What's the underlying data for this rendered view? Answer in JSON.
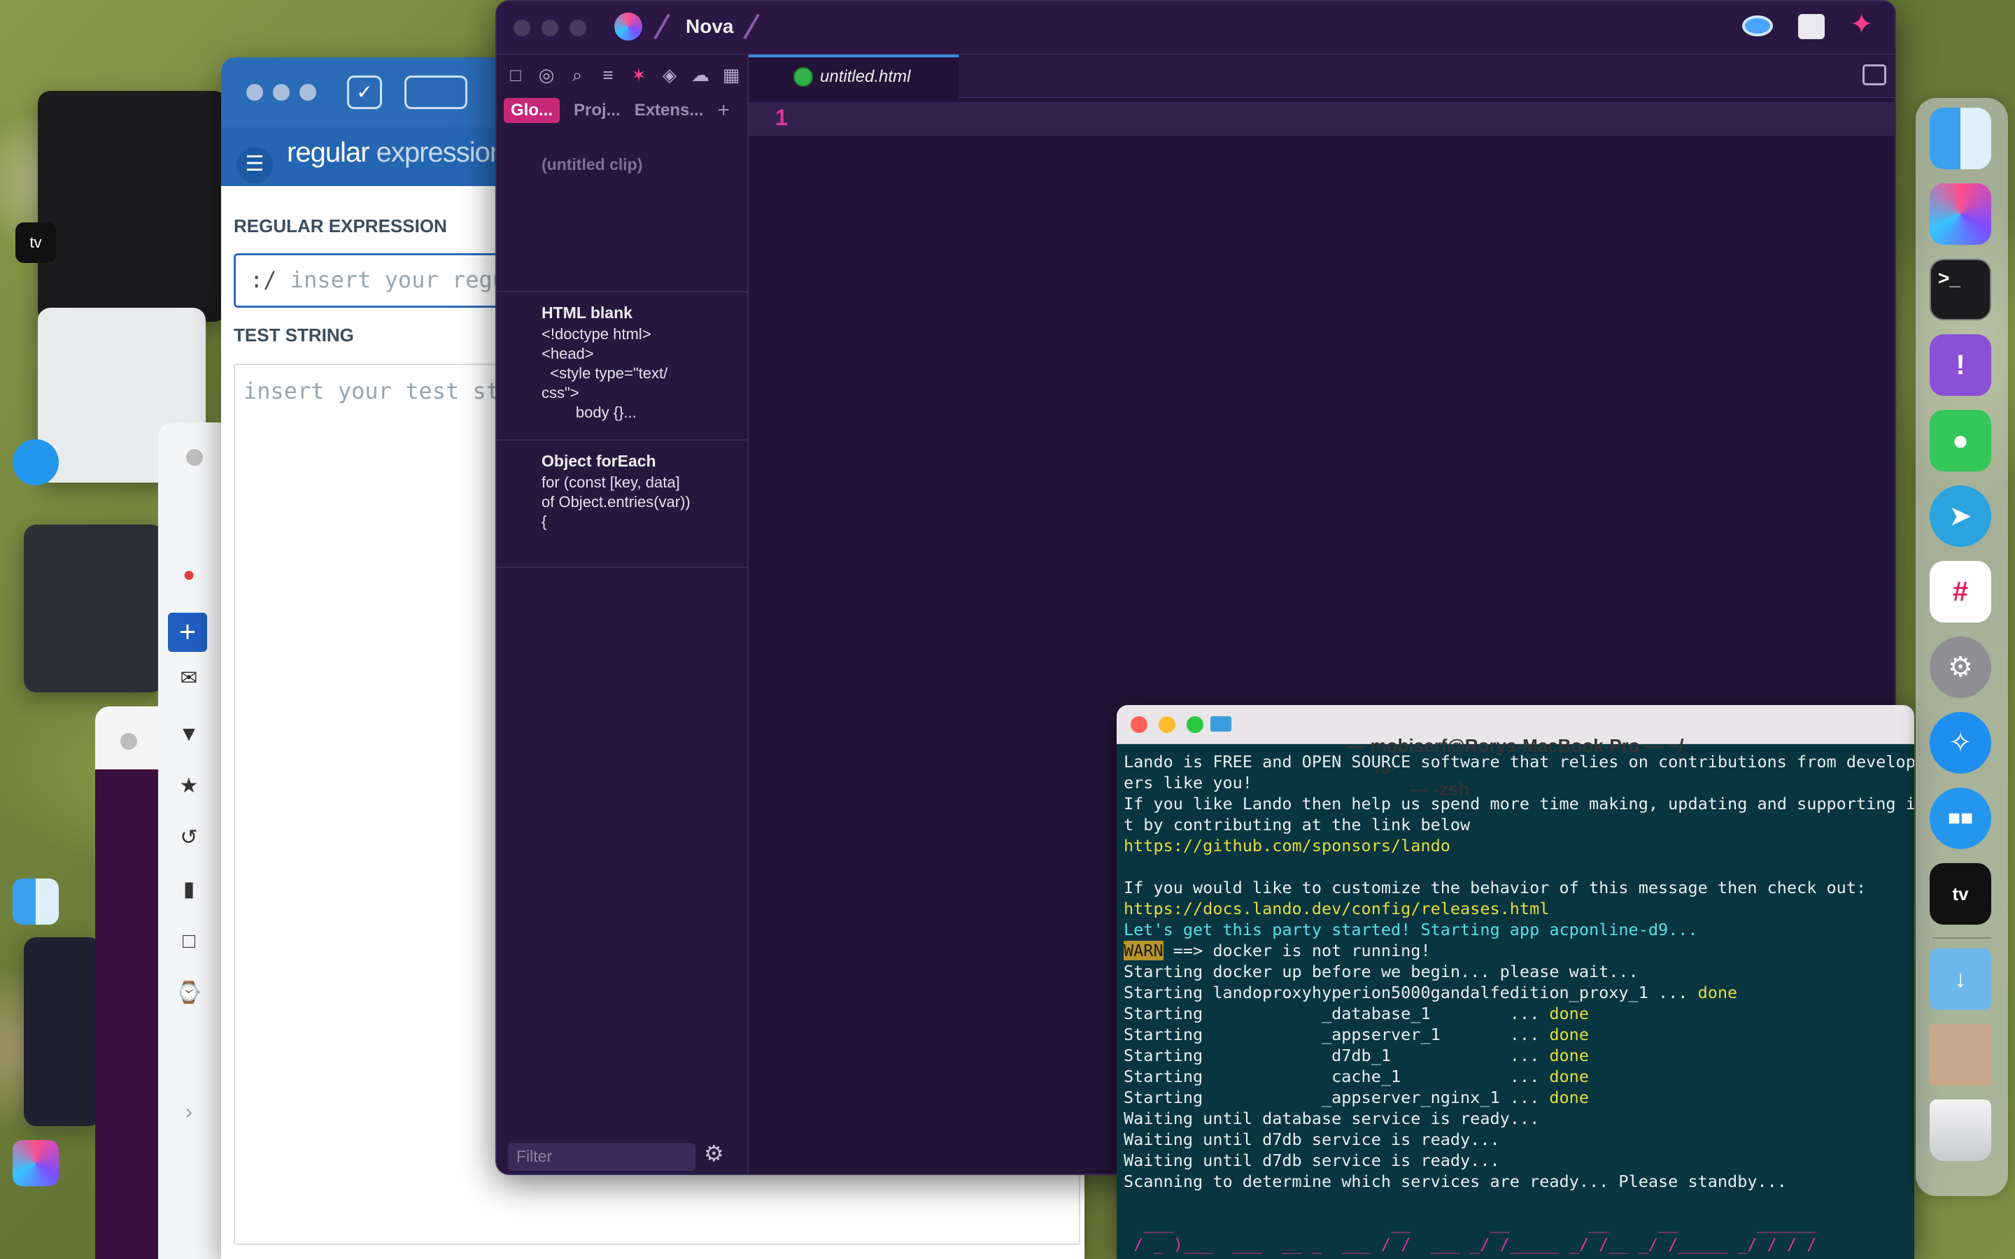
{
  "nova": {
    "app_name": "Nova",
    "sidebar_tabs": [
      "Glo...",
      "Proj...",
      "Extens..."
    ],
    "clips": [
      {
        "title": "(untitled clip)",
        "body": ""
      },
      {
        "title": "HTML blank",
        "body": "<!doctype html>\n<head>\n  <style type=\"text/\ncss\">\n        body {}..."
      },
      {
        "title": "Object forEach",
        "body": "for (const [key, data]\nof Object.entries(var))\n{"
      }
    ],
    "filter_placeholder": "Filter",
    "tab_label": "untitled.html",
    "line_number": "1"
  },
  "regex": {
    "logo_main": "regular",
    "logo_sub": "expressions",
    "regex_label": "REGULAR EXPRESSION",
    "regex_placeholder": "insert your regul",
    "regex_prefix": ":/",
    "test_label": "TEST STRING",
    "test_placeholder": "insert your test str"
  },
  "terminal": {
    "title_left": "— mobiserf@Rorys-MacBook-Pro — ~/",
    "title_mid": "/9·",
    "title_right": "— -zsh",
    "lines": {
      "l1": "Lando is FREE and OPEN SOURCE software that relies on contributions from develop",
      "l2": "ers like you!",
      "l3": "If you like Lando then help us spend more time making, updating and supporting i",
      "l4": "t by contributing at the link below",
      "l5": "https://github.com/sponsors/lando",
      "l6": "If you would like to customize the behavior of this message then check out:",
      "l7": "https://docs.lando.dev/config/releases.html",
      "l8": "Let's get this party started! Starting app acponline-d9...",
      "l9_tag": "WARN",
      "l9": " ==> docker is not running!",
      "l10": "Starting docker up before we begin... please wait...",
      "l11": "Starting landoproxyhyperion5000gandalfedition_proxy_1 ... ",
      "l12": "Starting            _database_1        ... ",
      "l13": "Starting            _appserver_1       ... ",
      "l14": "Starting             d7db_1            ... ",
      "l15": "Starting             cache_1           ... ",
      "l16": "Starting            _appserver_nginx_1 ... ",
      "done": "done",
      "l17": "Waiting until database service is ready...",
      "l18": "Waiting until d7db service is ready...",
      "l19": "Waiting until d7db service is ready...",
      "l20": "Scanning to determine which services are ready... Please standby...",
      "art1": "  ___                      __        __        __     __        ______",
      "art2": " / _ )___  ___  __ _  ___ / /  ___ _/ /_____ _/ /__ _/ /_____ _/ / / /"
    }
  },
  "colors": {
    "nova_bg": "#221338",
    "nova_accent": "#c8287a",
    "regex_blue": "#2566b3",
    "terminal_bg": "#083540"
  },
  "icons": {
    "dock": [
      "finder-icon",
      "nova-icon",
      "terminal-icon",
      "feedback-icon",
      "messages-icon",
      "telegram-icon",
      "slack-icon",
      "system-settings-icon",
      "safari-icon",
      "docker-icon",
      "apple-tv-icon",
      "downloads-folder-icon",
      "photo-stack-icon",
      "trash-icon"
    ]
  }
}
